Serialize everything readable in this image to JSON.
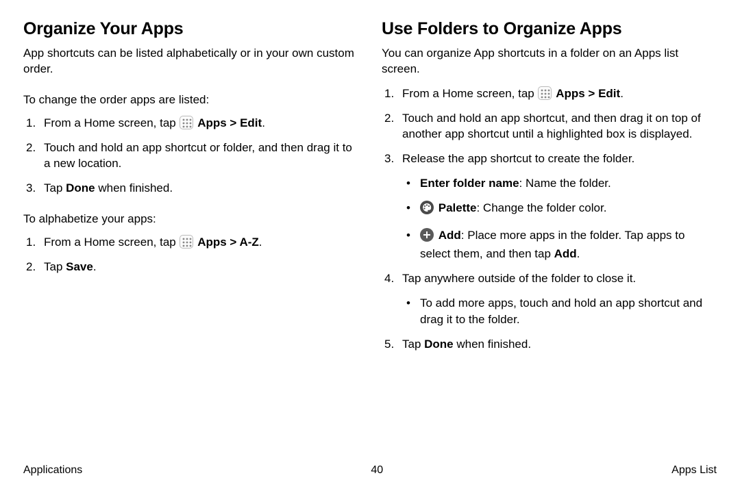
{
  "left": {
    "heading": "Organize Your Apps",
    "intro": "App shortcuts can be listed alphabetically or in your own custom order.",
    "subhead1": "To change the order apps are listed:",
    "list1": {
      "i1_pre": "From a Home screen, tap ",
      "i1_post": "Apps > Edit",
      "i1_end": ".",
      "i2": "Touch and hold an app shortcut or folder, and then drag it to a new location.",
      "i3_pre": "Tap ",
      "i3_bold": "Done",
      "i3_post": " when finished."
    },
    "subhead2": "To alphabetize your apps:",
    "list2": {
      "i1_pre": "From a Home screen, tap ",
      "i1_post": "Apps > A-Z",
      "i1_end": ".",
      "i2_pre": "Tap ",
      "i2_bold": "Save",
      "i2_post": "."
    }
  },
  "right": {
    "heading": "Use Folders to Organize Apps",
    "intro": "You can organize App shortcuts in a folder on an Apps list screen.",
    "list": {
      "i1_pre": "From a Home screen, tap ",
      "i1_post": "Apps > Edit",
      "i1_end": ".",
      "i2": "Touch and hold an app shortcut, and then drag it on top of another app shortcut until a highlighted box is displayed.",
      "i3": "Release the app shortcut to create the folder.",
      "b1_bold": "Enter folder name",
      "b1_rest": ": Name the folder.",
      "b2_bold": "Palette",
      "b2_rest": ": Change the folder color.",
      "b3_bold": "Add",
      "b3_rest_a": ": Place more apps in the folder. Tap apps to select them, and then tap ",
      "b3_rest_b": "Add",
      "b3_rest_c": ".",
      "i4": "Tap anywhere outside of the folder to close it.",
      "b4": "To add more apps, touch and hold an app shortcut and drag it to the folder.",
      "i5_pre": "Tap ",
      "i5_bold": "Done",
      "i5_post": " when finished."
    }
  },
  "footer": {
    "left": "Applications",
    "center": "40",
    "right": "Apps List"
  }
}
